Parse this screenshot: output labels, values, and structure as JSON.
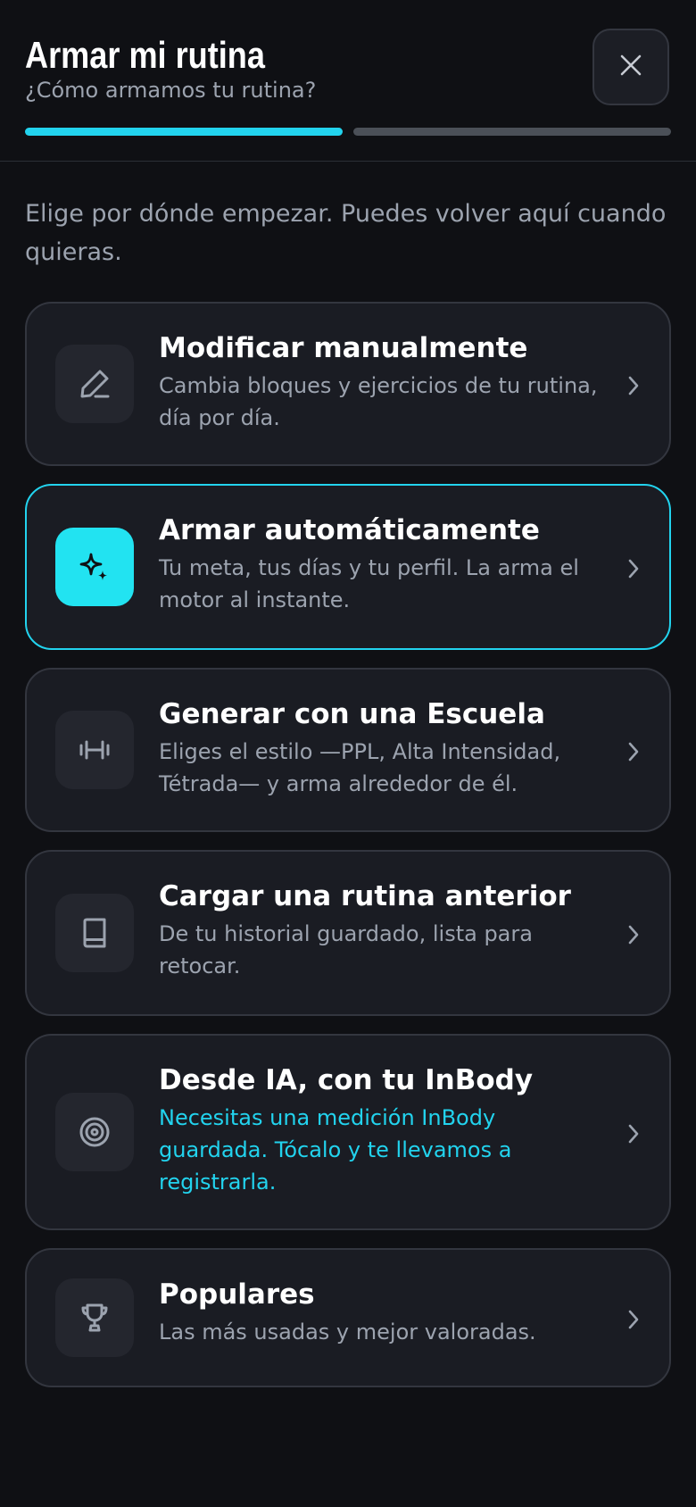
{
  "header": {
    "title": "Armar mi rutina",
    "subtitle": "¿Cómo armamos tu rutina?",
    "close_icon": "close-icon",
    "progress": {
      "current_step": 1,
      "total_steps": 2
    }
  },
  "intro": "Elige por dónde empezar. Puedes volver aquí cuando quieras.",
  "options": [
    {
      "title": "Modificar manualmente",
      "description": "Cambia bloques y ejercicios de tu rutina, día por día.",
      "icon": "pencil-icon",
      "selected": false
    },
    {
      "title": "Armar automáticamente",
      "description": "Tu meta, tus días y tu perfil. La arma el motor al instante.",
      "icon": "sparkles-icon",
      "selected": true
    },
    {
      "title": "Generar con una Escuela",
      "description": "Eliges el estilo —PPL, Alta Intensidad, Tétrada— y arma alrededor de él.",
      "icon": "dumbbell-icon",
      "selected": false
    },
    {
      "title": "Cargar una rutina anterior",
      "description": "De tu historial guardado, lista para retocar.",
      "icon": "book-icon",
      "selected": false
    },
    {
      "title": "Desde IA, con tu InBody",
      "description": "Necesitas una medición InBody guardada. Tócalo y te llevamos a registrarla.",
      "icon": "target-icon",
      "selected": false
    },
    {
      "title": "Populares",
      "description": "Las más usadas y mejor valoradas.",
      "icon": "trophy-icon",
      "selected": false
    }
  ],
  "colors": {
    "background": "#0f1014",
    "card": "#1a1c23",
    "accent": "#22d3ee",
    "muted_text": "#9ca3af"
  }
}
